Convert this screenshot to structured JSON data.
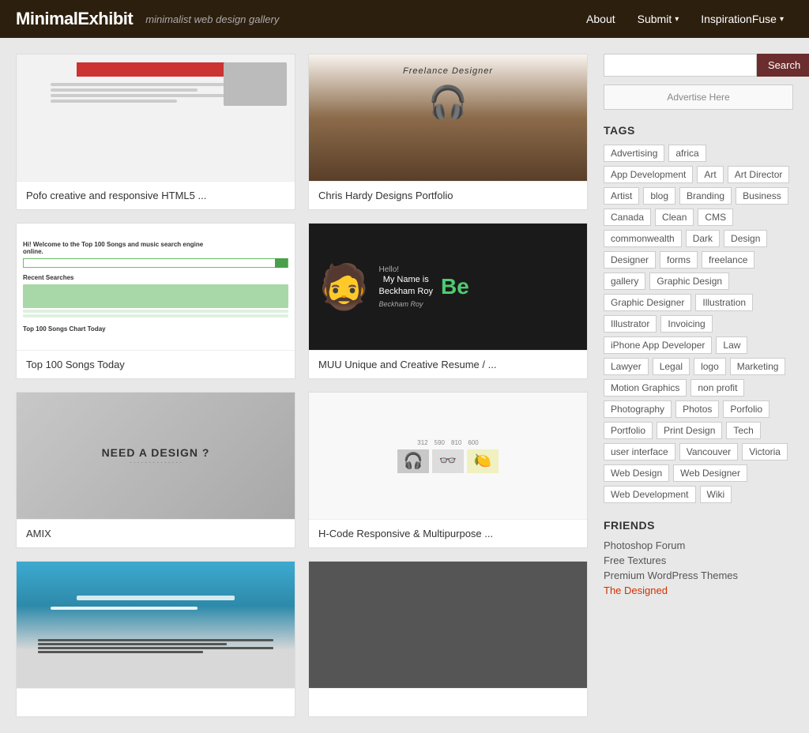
{
  "header": {
    "site_title": "MinimalExhibit",
    "site_tagline": "minimalist web design gallery",
    "nav": [
      {
        "label": "About",
        "has_arrow": false
      },
      {
        "label": "Submit",
        "has_arrow": true
      },
      {
        "label": "InspirationFuse",
        "has_arrow": true
      }
    ]
  },
  "sidebar": {
    "search_placeholder": "",
    "search_button_label": "Search",
    "advertise_label": "Advertise Here",
    "tags_title": "TAGS",
    "tags": [
      "Advertising",
      "africa",
      "App Development",
      "Art",
      "Art Director",
      "Artist",
      "blog",
      "Branding",
      "Business",
      "Canada",
      "Clean",
      "CMS",
      "commonwealth",
      "Dark",
      "Design",
      "Designer",
      "forms",
      "freelance",
      "gallery",
      "Graphic Design",
      "Graphic Designer",
      "Illustration",
      "Illustrator",
      "Invoicing",
      "iPhone App Developer",
      "Law",
      "Lawyer",
      "Legal",
      "logo",
      "Marketing",
      "Motion Graphics",
      "non profit",
      "Photography",
      "Photos",
      "Porfolio",
      "Portfolio",
      "Print Design",
      "Tech",
      "user interface",
      "Vancouver",
      "Victoria",
      "Web Design",
      "Web Designer",
      "Web Development",
      "Wiki"
    ],
    "friends_title": "FRIENDS",
    "friends": [
      {
        "label": "Photoshop Forum",
        "highlight": false
      },
      {
        "label": "Free Textures",
        "highlight": false
      },
      {
        "label": "Premium WordPress Themes",
        "highlight": false
      },
      {
        "label": "The Designed",
        "highlight": true
      }
    ]
  },
  "cards": [
    {
      "title": "Pofo creative and responsive HTML5 ...",
      "thumb": "pofo"
    },
    {
      "title": "Chris Hardy Designs Portfolio",
      "thumb": "chris"
    },
    {
      "title": "Top 100 Songs Today",
      "thumb": "songs"
    },
    {
      "title": "MUU Unique and Creative Resume / ...",
      "thumb": "muu"
    },
    {
      "title": "AMIX",
      "thumb": "amix"
    },
    {
      "title": "H-Code Responsive & Multipurpose ...",
      "thumb": "hcode"
    },
    {
      "title": "",
      "thumb": "bottom1"
    },
    {
      "title": "",
      "thumb": "bottom2"
    }
  ]
}
